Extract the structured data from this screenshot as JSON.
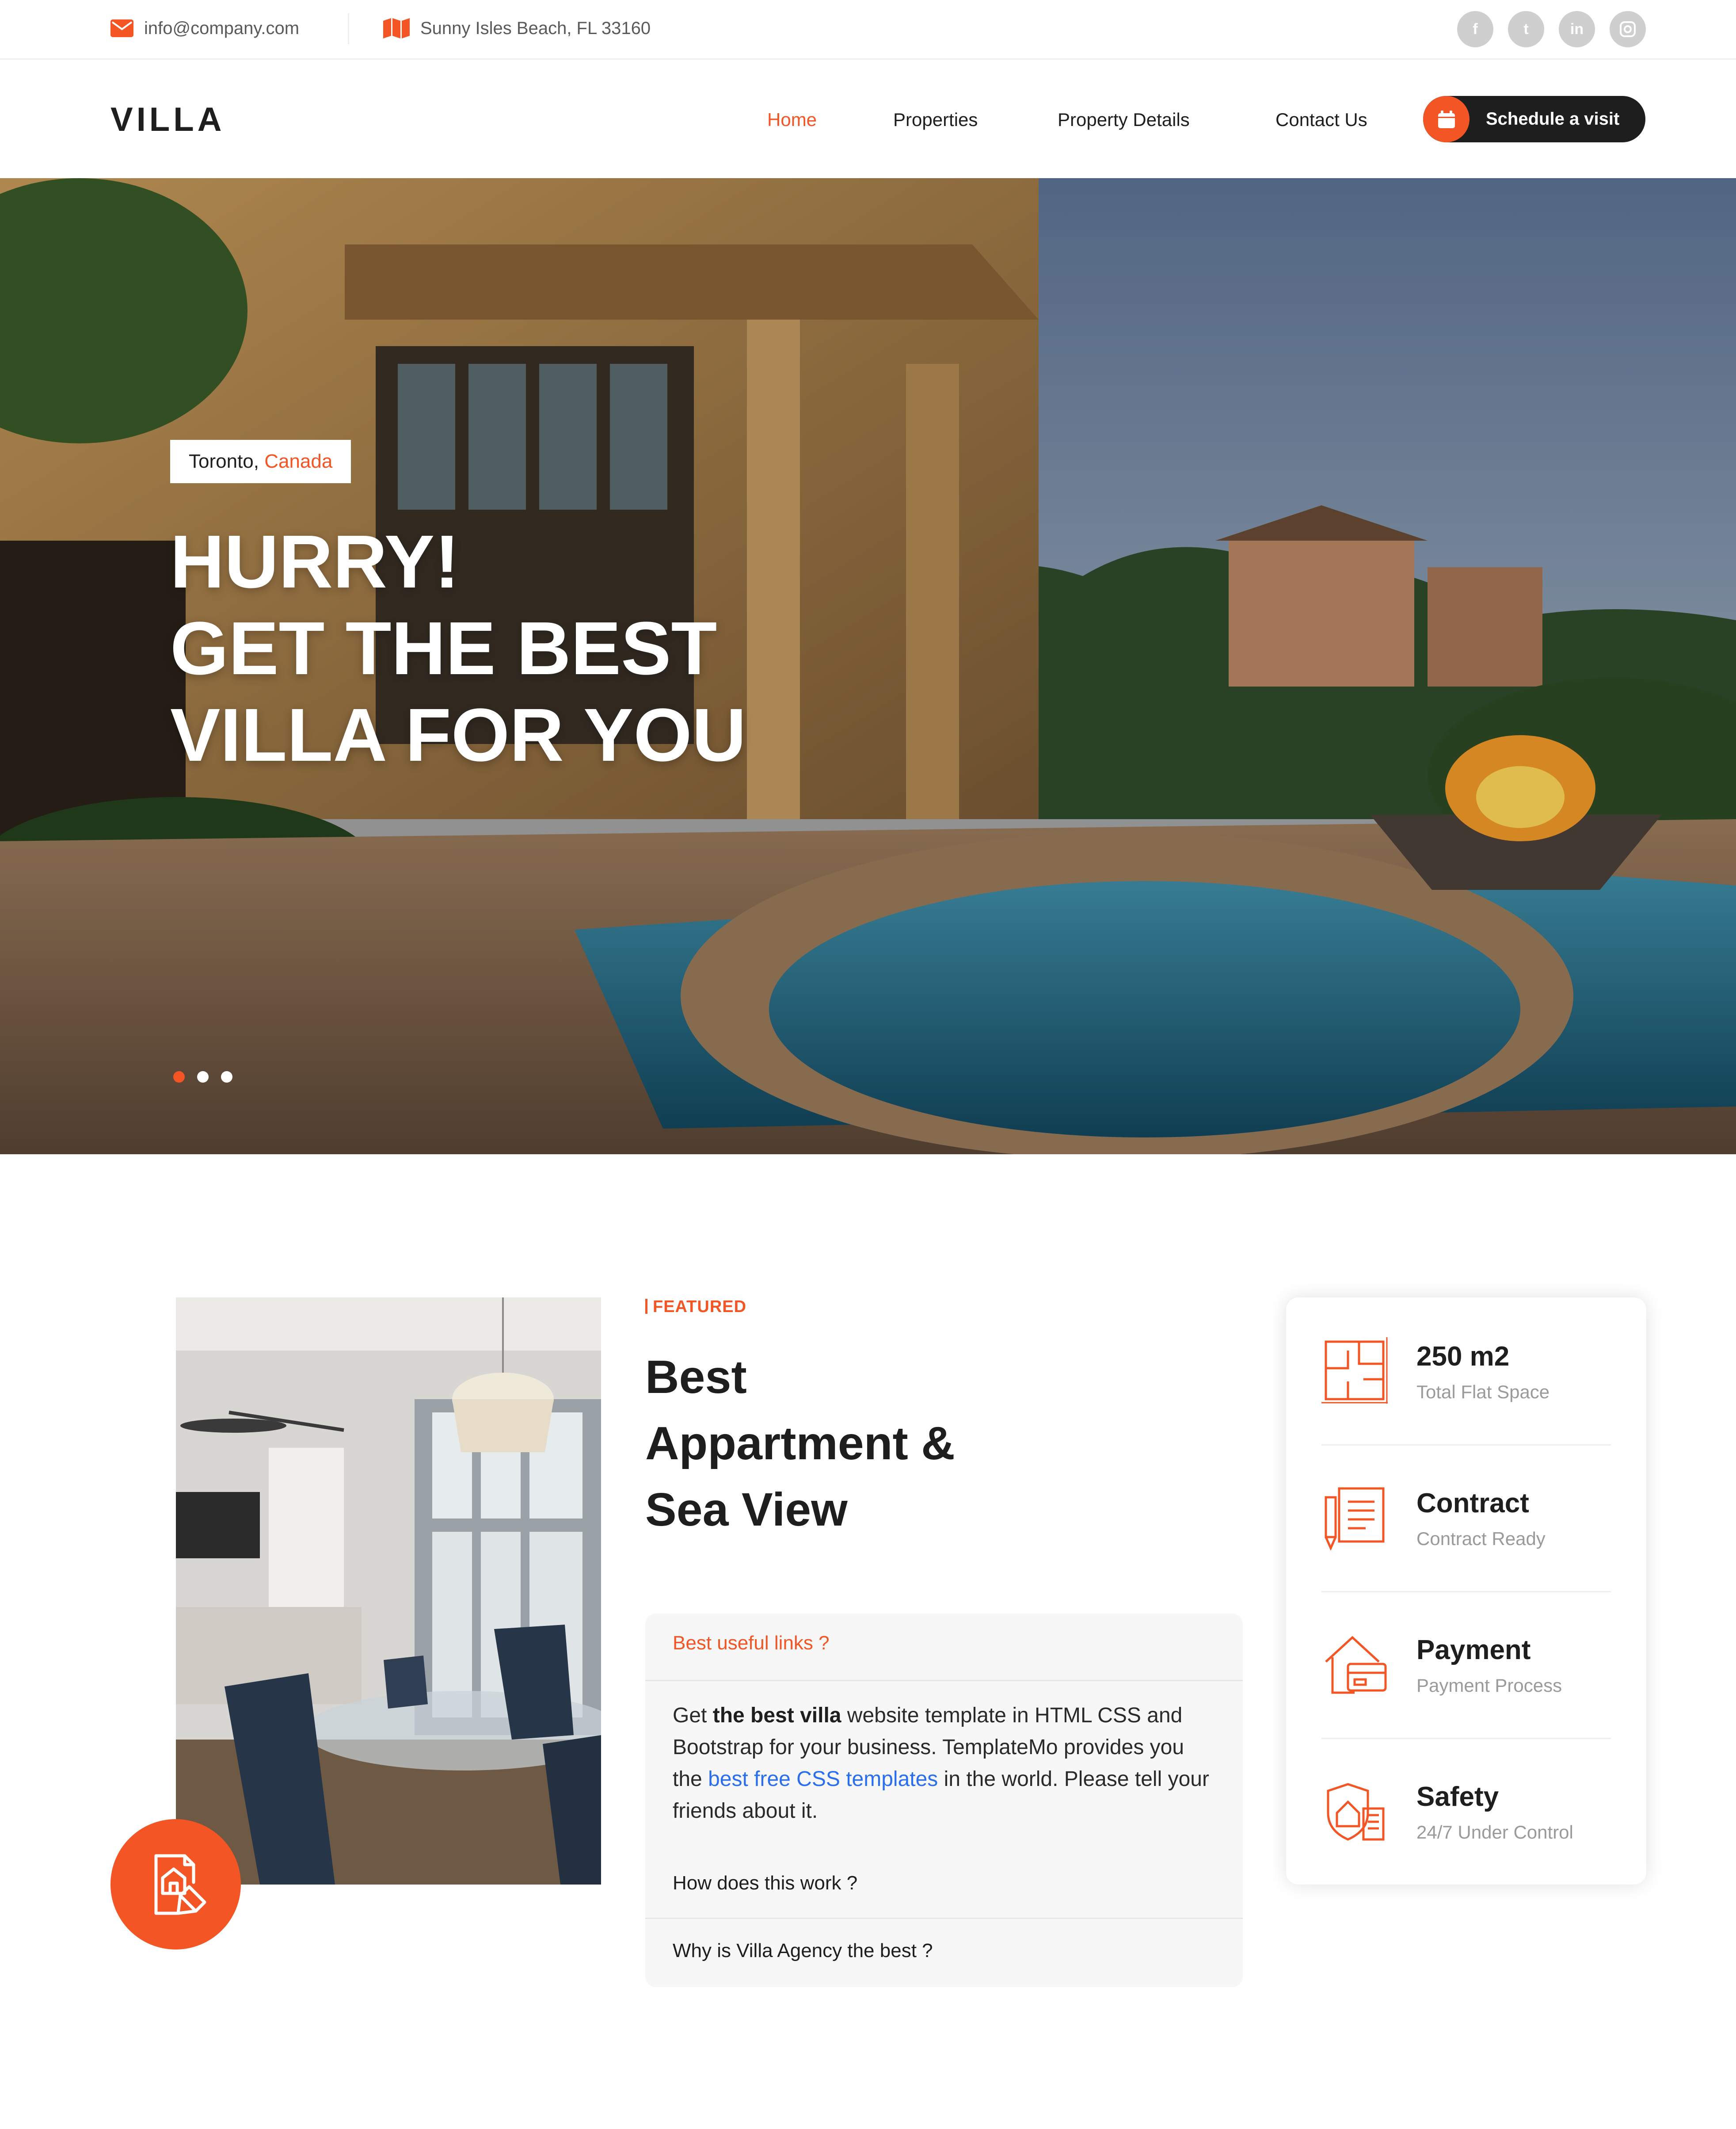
{
  "topbar": {
    "email": "info@company.com",
    "address": "Sunny Isles Beach, FL 33160",
    "socials": [
      "facebook-icon",
      "twitter-icon",
      "linkedin-icon",
      "instagram-icon"
    ]
  },
  "header": {
    "logo": "VILLA",
    "nav": [
      {
        "label": "Home",
        "active": true
      },
      {
        "label": "Properties",
        "active": false
      },
      {
        "label": "Property Details",
        "active": false
      },
      {
        "label": "Contact Us",
        "active": false
      }
    ],
    "cta_label": "Schedule a visit"
  },
  "hero": {
    "city": "Toronto,",
    "country": "Canada",
    "title_line1": "HURRY!",
    "title_line2": "GET THE BEST",
    "title_line3": "VILLA FOR YOU",
    "slides": 3,
    "active_slide": 1
  },
  "featured": {
    "eyebrow": "FEATURED",
    "title_line1": "Best",
    "title_line2": "Appartment &",
    "title_line3": "Sea View",
    "accordion": {
      "q1": "Best useful links ?",
      "a1_part1": "Get ",
      "a1_bold": "the best villa",
      "a1_part2": " website template in HTML CSS and Bootstrap for your business. TemplateMo provides you the ",
      "a1_link": "best free CSS templates",
      "a1_part3": " in the world. Please tell your friends about it.",
      "q2": "How does this work ?",
      "q3": "Why is Villa Agency the best ?"
    },
    "info": [
      {
        "value": "250 m2",
        "label": "Total Flat Space",
        "icon": "floor-plan-icon"
      },
      {
        "value": "Contract",
        "label": "Contract Ready",
        "icon": "contract-icon"
      },
      {
        "value": "Payment",
        "label": "Payment Process",
        "icon": "payment-house-icon"
      },
      {
        "value": "Safety",
        "label": "24/7 Under Control",
        "icon": "safety-shield-icon"
      }
    ]
  },
  "colors": {
    "accent": "#f35525",
    "dark": "#1e1e1e",
    "muted": "#9a9a9a",
    "link": "#2a6ef0"
  }
}
